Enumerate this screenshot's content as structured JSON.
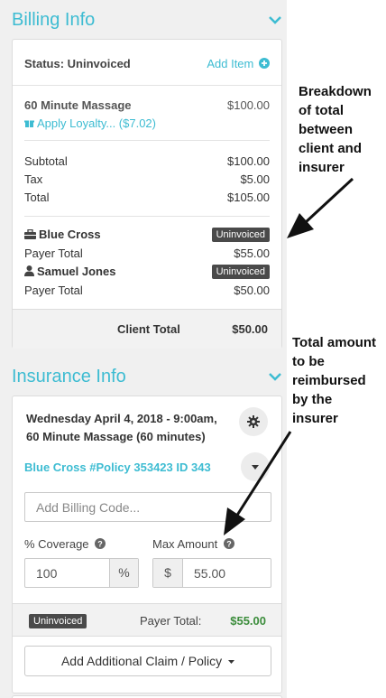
{
  "billing": {
    "title": "Billing Info",
    "status_label": "Status: Uninvoiced",
    "add_item_label": "Add Item",
    "service": {
      "name": "60 Minute Massage",
      "price": "$100.00"
    },
    "loyalty": "Apply Loyalty... ($7.02)",
    "subtotal": {
      "label": "Subtotal",
      "value": "$100.00"
    },
    "tax": {
      "label": "Tax",
      "value": "$5.00"
    },
    "total": {
      "label": "Total",
      "value": "$105.00"
    },
    "payers": [
      {
        "name": "Blue Cross",
        "icon": "briefcase-icon",
        "status": "Uninvoiced",
        "total_label": "Payer Total",
        "total": "$55.00"
      },
      {
        "name": "Samuel Jones",
        "icon": "user-icon",
        "status": "Uninvoiced",
        "total_label": "Payer Total",
        "total": "$50.00"
      }
    ],
    "client_total_label": "Client Total",
    "client_total": "$50.00"
  },
  "insurance": {
    "title": "Insurance Info",
    "appointment_line1": "Wednesday April 4, 2018 - 9:00am,",
    "appointment_line2": "60 Minute Massage (60 minutes)",
    "policy": "Blue Cross #Policy 353423 ID 343",
    "billing_code_placeholder": "Add Billing Code...",
    "coverage_label": "% Coverage",
    "coverage_value": "100",
    "coverage_unit": "%",
    "max_amount_label": "Max Amount",
    "max_amount_currency": "$",
    "max_amount_value": "55.00",
    "status": "Uninvoiced",
    "payer_total_label": "Payer Total:",
    "payer_total": "$55.00",
    "add_claim_label": "Add Additional Claim / Policy"
  },
  "annotations": {
    "breakdown": [
      "Breakdown",
      "of total",
      "between",
      "client and",
      "insurer"
    ],
    "reimbursed": [
      "Total amount",
      "to be",
      "reimbursed",
      "by the",
      "insurer"
    ]
  },
  "colors": {
    "accent": "#3dbcd2",
    "success": "#3c8d3c",
    "badge": "#4a4a4a"
  }
}
